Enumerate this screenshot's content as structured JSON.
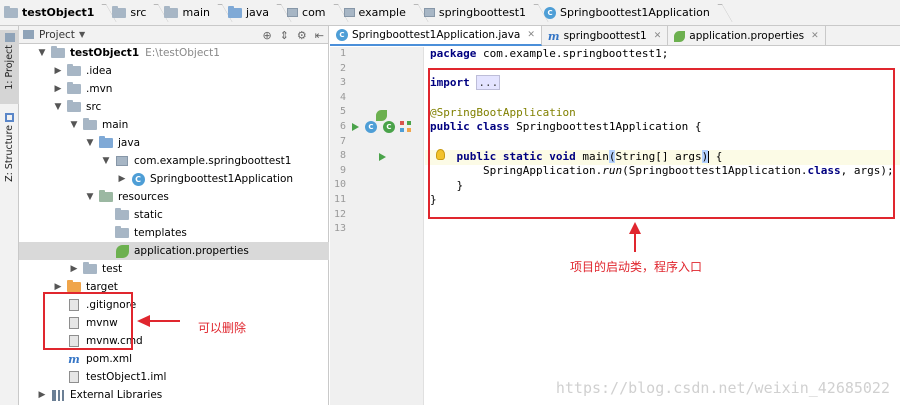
{
  "breadcrumbs": [
    {
      "label": "testObject1",
      "icon": "project-folder-icon",
      "bold": true
    },
    {
      "label": "src",
      "icon": "folder-icon"
    },
    {
      "label": "main",
      "icon": "folder-icon"
    },
    {
      "label": "java",
      "icon": "source-folder-icon"
    },
    {
      "label": "com",
      "icon": "package-icon"
    },
    {
      "label": "example",
      "icon": "package-icon"
    },
    {
      "label": "springboottest1",
      "icon": "package-icon"
    },
    {
      "label": "Springboottest1Application",
      "icon": "spring-class-icon"
    }
  ],
  "strip": {
    "project_tab": "1: Project",
    "structure_tab": "Z: Structure"
  },
  "project_panel": {
    "header_label": "Project",
    "header_icons": [
      "target-icon",
      "collapse-icon",
      "gear-icon",
      "hide-icon"
    ]
  },
  "tree": [
    {
      "label": "testObject1",
      "path": "E:\\testObject1",
      "depth": 0,
      "arrow": "open",
      "icon": "folder"
    },
    {
      "label": ".idea",
      "depth": 1,
      "arrow": "closed",
      "icon": "folder"
    },
    {
      "label": ".mvn",
      "depth": 1,
      "arrow": "closed",
      "icon": "folder"
    },
    {
      "label": "src",
      "depth": 1,
      "arrow": "open",
      "icon": "folder"
    },
    {
      "label": "main",
      "depth": 2,
      "arrow": "open",
      "icon": "folder"
    },
    {
      "label": "java",
      "depth": 3,
      "arrow": "open",
      "icon": "folder-src"
    },
    {
      "label": "com.example.springboottest1",
      "depth": 4,
      "arrow": "open",
      "icon": "package"
    },
    {
      "label": "Springboottest1Application",
      "depth": 5,
      "arrow": "closed",
      "icon": "class"
    },
    {
      "label": "resources",
      "depth": 3,
      "arrow": "open",
      "icon": "folder-res"
    },
    {
      "label": "static",
      "depth": 4,
      "arrow": "none",
      "icon": "folder"
    },
    {
      "label": "templates",
      "depth": 4,
      "arrow": "none",
      "icon": "folder"
    },
    {
      "label": "application.properties",
      "depth": 4,
      "arrow": "none",
      "icon": "leaf",
      "selected": true
    },
    {
      "label": "test",
      "depth": 2,
      "arrow": "closed",
      "icon": "folder"
    },
    {
      "label": "target",
      "depth": 1,
      "arrow": "closed",
      "icon": "folder-orange"
    },
    {
      "label": ".gitignore",
      "depth": 1,
      "arrow": "none",
      "icon": "file"
    },
    {
      "label": "mvnw",
      "depth": 1,
      "arrow": "none",
      "icon": "file"
    },
    {
      "label": "mvnw.cmd",
      "depth": 1,
      "arrow": "none",
      "icon": "file"
    },
    {
      "label": "pom.xml",
      "depth": 1,
      "arrow": "none",
      "icon": "maven"
    },
    {
      "label": "testObject1.iml",
      "depth": 1,
      "arrow": "none",
      "icon": "file"
    },
    {
      "label": "External Libraries",
      "depth": 0,
      "arrow": "closed",
      "icon": "libs"
    }
  ],
  "tabs": [
    {
      "label": "Springboottest1Application.java",
      "icon": "spring-class-icon",
      "active": true
    },
    {
      "label": "springboottest1",
      "icon": "maven-icon",
      "active": false
    },
    {
      "label": "application.properties",
      "icon": "leaf-icon",
      "active": false
    }
  ],
  "editor": {
    "line_numbers": [
      "1",
      "2",
      "3",
      "4",
      "5",
      "6",
      "7",
      "8",
      "9",
      "10",
      "11",
      "12",
      "13"
    ],
    "line1": {
      "kw": "package",
      "rest": " com.example.springboottest1;"
    },
    "line3": {
      "kw": "import",
      "folded": "..."
    },
    "line5": {
      "annotation": "@SpringBootApplication"
    },
    "line6": {
      "kw": "public class",
      "rest": " Springboottest1Application {"
    },
    "line9": {
      "kw": "public static void",
      "pre": " main",
      "paren_open": "(",
      "args": "String[] args",
      "paren_close": ")",
      "post": " {"
    },
    "line10": {
      "pre": "SpringApplication.",
      "method": "run",
      "args": "(Springboottest1Application.",
      "kw": "class",
      "post": ", args);"
    },
    "line11": {
      "text": "}"
    },
    "line12": {
      "text": "}"
    }
  },
  "annotations": {
    "delete_label": "可以删除",
    "entry_label": "项目的启动类，程序入口",
    "color": "#e0262e"
  },
  "watermark": "https://blog.csdn.net/weixin_42685022"
}
